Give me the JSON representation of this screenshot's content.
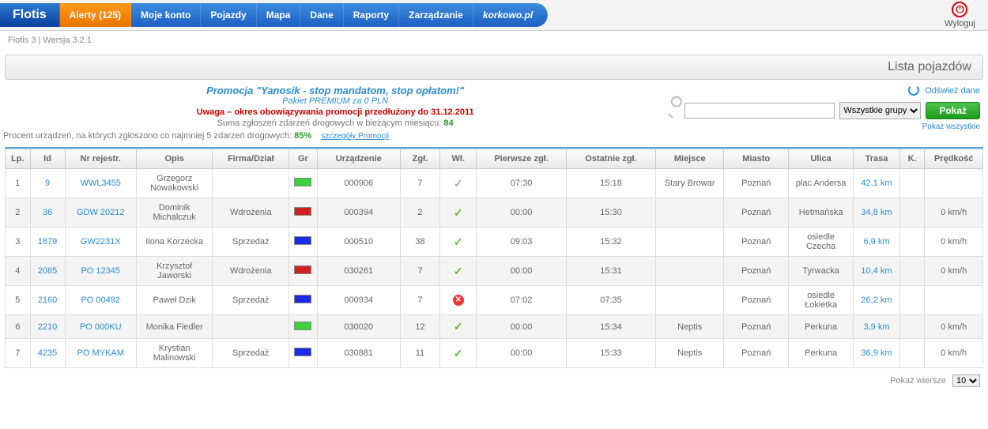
{
  "nav": {
    "brand": "Flotis",
    "alerts": "Alerty (125)",
    "konto": "Moje konto",
    "pojazdy": "Pojazdy",
    "mapa": "Mapa",
    "dane": "Dane",
    "raporty": "Raporty",
    "zarzadzanie": "Zarządzanie",
    "korkowo": "korkowo.pl",
    "logout": "Wyloguj"
  },
  "version": "Flotis 3 | Wersja 3.2.1",
  "title": "Lista pojazdów",
  "refresh": "Odśwież dane",
  "promo": {
    "title": "Promocja \"Yanosik - stop mandatom, stop opłatom!\"",
    "pack": "Pakiet PREMIUM za 0 PLN",
    "warn": "Uwaga – okres obowiązywania promocji przedłużony do 31.12.2011",
    "sum_prefix": "Suma zgłoszeń zdarzeń drogowych w bieżącym miesiącu:  ",
    "sum_value": "84",
    "pct_prefix": "Procent urządzeń, na których zgłoszono co najmniej 5 zdarzeń drogowych:  ",
    "pct_value": "85%",
    "details": "szczegóły Promocji"
  },
  "search": {
    "placeholder": "",
    "group": "Wszystkie grupy",
    "show": "Pokaż",
    "show_all": "Pokaż wszystkie"
  },
  "head": {
    "lp": "Lp.",
    "id": "Id",
    "nr": "Nr rejestr.",
    "op": "Opis",
    "fd": "Firma/Dział",
    "gr": "Gr",
    "ur": "Urządzenie",
    "zg": "Zgł.",
    "wl": "Wł.",
    "pz": "Pierwsze zgł.",
    "oz": "Ostatnie zgł.",
    "mi": "Miejsce",
    "ms": "Miasto",
    "ul": "Ulica",
    "tr": "Trasa",
    "k": "K.",
    "pr": "Prędkość"
  },
  "rows": [
    {
      "lp": "1",
      "id": "9",
      "nr": "WWL3455",
      "op": "Grzegorz Nowakowski",
      "fd": "",
      "gr": "green",
      "ur": "000906",
      "zg": "7",
      "wl": "grey",
      "pz": "07:30",
      "oz": "15:18",
      "mi": "Stary Browar",
      "ms": "Poznań",
      "ul": "plac Andersa",
      "tr": "42,1 km",
      "k": "",
      "pr": ""
    },
    {
      "lp": "2",
      "id": "36",
      "nr": "GDW 20212",
      "op": "Dominik Michalczuk",
      "fd": "Wdrożenia",
      "gr": "red",
      "ur": "000394",
      "zg": "2",
      "wl": "ok",
      "pz": "00:00",
      "oz": "15:30",
      "mi": "",
      "ms": "Poznań",
      "ul": "Hetmańska",
      "tr": "34,8 km",
      "k": "",
      "pr": "0 km/h"
    },
    {
      "lp": "3",
      "id": "1879",
      "nr": "GW2231X",
      "op": "Ilona Korzecka",
      "fd": "Sprzedaż",
      "gr": "blue",
      "ur": "000510",
      "zg": "38",
      "wl": "ok",
      "pz": "09:03",
      "oz": "15:32",
      "mi": "",
      "ms": "Poznań",
      "ul": "osiedle Czecha",
      "tr": "6,9 km",
      "k": "",
      "pr": "0 km/h"
    },
    {
      "lp": "4",
      "id": "2085",
      "nr": "PO 12345",
      "op": "Krzysztof Jaworski",
      "fd": "Wdrożenia",
      "gr": "red",
      "ur": "030261",
      "zg": "7",
      "wl": "ok",
      "pz": "00:00",
      "oz": "15:31",
      "mi": "",
      "ms": "Poznań",
      "ul": "Tyrwacka",
      "tr": "10,4 km",
      "k": "",
      "pr": "0 km/h"
    },
    {
      "lp": "5",
      "id": "2160",
      "nr": "PO 00492",
      "op": "Paweł Dzik",
      "fd": "Sprzedaż",
      "gr": "blue",
      "ur": "000934",
      "zg": "7",
      "wl": "err",
      "pz": "07:02",
      "oz": "07:35",
      "mi": "",
      "ms": "Poznań",
      "ul": "osiedle Łokietka",
      "tr": "26,2 km",
      "k": "",
      "pr": ""
    },
    {
      "lp": "6",
      "id": "2210",
      "nr": "PO 000KU",
      "op": "Monika Fiedler",
      "fd": "",
      "gr": "green",
      "ur": "030020",
      "zg": "12",
      "wl": "ok",
      "pz": "00:00",
      "oz": "15:34",
      "mi": "Neptis",
      "ms": "Poznań",
      "ul": "Perkuna",
      "tr": "3,9 km",
      "k": "",
      "pr": "0 km/h"
    },
    {
      "lp": "7",
      "id": "4235",
      "nr": "PO MYKAM",
      "op": "Krystian Malinowski",
      "fd": "Sprzedaż",
      "gr": "blue",
      "ur": "030881",
      "zg": "11",
      "wl": "ok",
      "pz": "00:00",
      "oz": "15:33",
      "mi": "Neptis",
      "ms": "Poznań",
      "ul": "Perkuna",
      "tr": "36,9 km",
      "k": "",
      "pr": "0 km/h"
    }
  ],
  "footer": {
    "label": "Pokaż wiersze",
    "page": "10"
  }
}
